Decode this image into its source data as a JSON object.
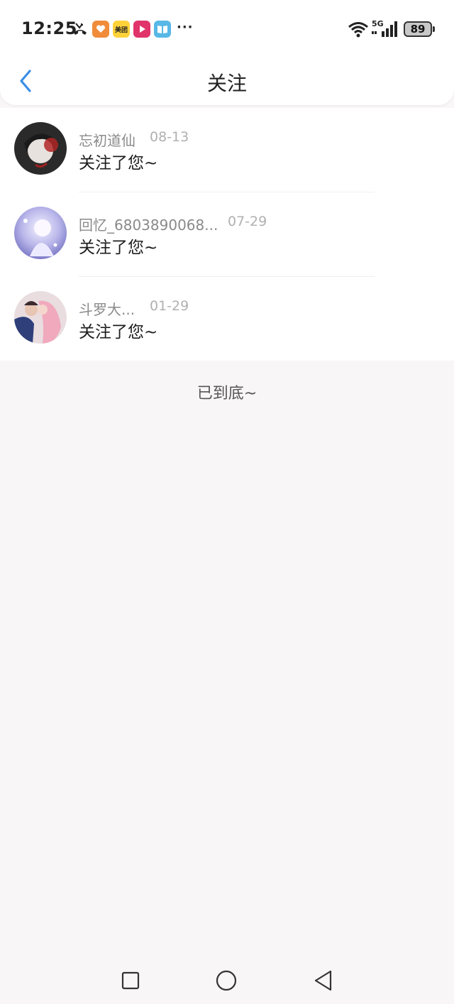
{
  "status_bar": {
    "time": "12:25",
    "network": "5G",
    "battery": "89",
    "app_badges": [
      {
        "name": "missed-call-icon"
      },
      {
        "name": "heart-app-icon",
        "color": "#f08c3a"
      },
      {
        "name": "meituan-app-icon",
        "label": "美团",
        "color": "#ffd23a"
      },
      {
        "name": "video-app-icon",
        "color": "#e0346b"
      },
      {
        "name": "book-app-icon",
        "color": "#58b8e6"
      }
    ],
    "more": "···"
  },
  "header": {
    "title": "关注",
    "back_icon": "chevron-left-icon",
    "accent": "#3a8ee6"
  },
  "notifications": [
    {
      "name": "忘初道仙",
      "date": "08-13",
      "message": "关注了您~"
    },
    {
      "name": "回忆_6803890068...",
      "date": "07-29",
      "message": "关注了您~"
    },
    {
      "name": "斗罗大...",
      "date": "01-29",
      "message": "关注了您~"
    }
  ],
  "footer_text": "已到底~",
  "system_nav": {
    "recent": "square-icon",
    "home": "circle-icon",
    "back": "triangle-back-icon"
  }
}
